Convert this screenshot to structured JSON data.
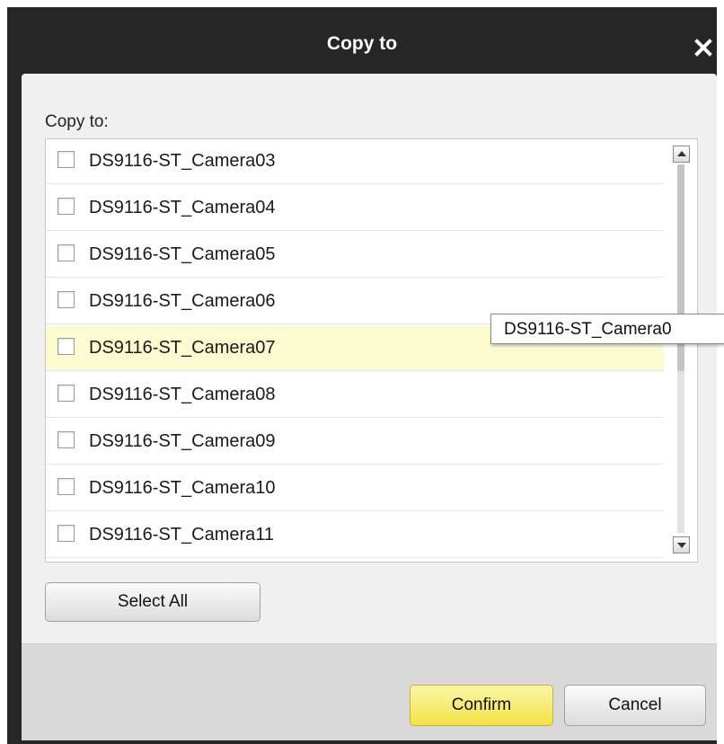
{
  "dialog": {
    "title": "Copy to",
    "close_icon": "close-icon"
  },
  "panel": {
    "label": "Copy to:"
  },
  "camera_list": {
    "items": [
      {
        "label": "DS9116-ST_Camera03",
        "checked": false
      },
      {
        "label": "DS9116-ST_Camera04",
        "checked": false
      },
      {
        "label": "DS9116-ST_Camera05",
        "checked": false
      },
      {
        "label": "DS9116-ST_Camera06",
        "checked": false
      },
      {
        "label": "DS9116-ST_Camera07",
        "checked": false,
        "hovered": true
      },
      {
        "label": "DS9116-ST_Camera08",
        "checked": false
      },
      {
        "label": "DS9116-ST_Camera09",
        "checked": false
      },
      {
        "label": "DS9116-ST_Camera10",
        "checked": false
      },
      {
        "label": "DS9116-ST_Camera11",
        "checked": false
      }
    ]
  },
  "tooltip": {
    "text": "DS9116-ST_Camera0"
  },
  "buttons": {
    "select_all": "Select All",
    "confirm": "Confirm",
    "cancel": "Cancel"
  },
  "colors": {
    "titlebar": "#262626",
    "panel": "#f0f0f0",
    "hover_row": "#fcfbd0",
    "confirm_button": "#f2e244"
  }
}
